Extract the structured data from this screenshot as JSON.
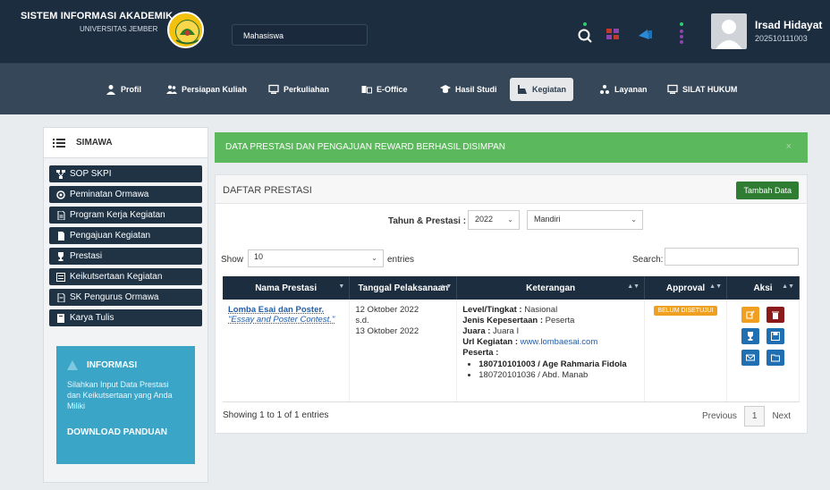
{
  "header": {
    "title": "SISTEM INFORMASI AKADEMIK",
    "subtitle": "UNIVERSITAS JEMBER",
    "role": "Mahasiswa",
    "user_name": "Irsad Hidayat",
    "user_nim": "202510111003"
  },
  "nav": {
    "items": [
      {
        "label": "Profil",
        "icon": "person-icon"
      },
      {
        "label": "Persiapan Kuliah",
        "icon": "users-icon"
      },
      {
        "label": "Perkuliahan",
        "icon": "screen-icon"
      },
      {
        "label": "E-Office",
        "icon": "office-icon"
      },
      {
        "label": "Hasil Studi",
        "icon": "graduation-icon"
      },
      {
        "label": "Kegiatan",
        "icon": "activity-icon"
      },
      {
        "label": "Layanan",
        "icon": "service-icon"
      },
      {
        "label": "SILAT HUKUM",
        "icon": "screen-icon"
      }
    ]
  },
  "sidebar": {
    "title": "SIMAWA",
    "items": [
      {
        "label": "SOP SKPI",
        "icon": "sitemap-icon"
      },
      {
        "label": "Peminatan Ormawa",
        "icon": "circle-icon"
      },
      {
        "label": "Program Kerja Kegiatan",
        "icon": "file-icon"
      },
      {
        "label": "Pengajuan Kegiatan",
        "icon": "file-icon"
      },
      {
        "label": "Prestasi",
        "icon": "trophy-icon"
      },
      {
        "label": "Keikutsertaan Kegiatan",
        "icon": "list-icon"
      },
      {
        "label": "SK Pengurus Ormawa",
        "icon": "file-icon"
      },
      {
        "label": "Karya Tulis",
        "icon": "book-icon"
      }
    ],
    "info": {
      "title": "INFORMASI",
      "text": "Silahkan Input Data Prestasi dan Keikutsertaan yang Anda Miliki",
      "download": "DOWNLOAD PANDUAN"
    }
  },
  "alert": {
    "message": "DATA PRESTASI DAN PENGAJUAN REWARD BERHASIL DISIMPAN",
    "close": "×"
  },
  "panel": {
    "title": "DAFTAR PRESTASI",
    "add_button": "Tambah Data",
    "filter_label": "Tahun & Prestasi",
    "filter_sep": ":",
    "year": "2022",
    "category": "Mandiri",
    "show_label": "Show",
    "show_value": "10",
    "entries_label": "entries",
    "search_label": "Search:",
    "columns": [
      "Nama Prestasi",
      "Tanggal Pelaksanaan",
      "Keterangan",
      "Approval",
      "Aksi"
    ],
    "row": {
      "name": "Lomba Esai dan Poster.",
      "name_en": "\"Essay and Poster Contest.\"",
      "date_start": "12 Oktober 2022",
      "date_sep": "s.d.",
      "date_end": "13 Oktober 2022",
      "level_label": "Level/Tingkat :",
      "level": "Nasional",
      "jenis_label": "Jenis Kepesertaan :",
      "jenis": "Peserta",
      "juara_label": "Juara :",
      "juara": "Juara I",
      "url_label": "Url Kegiatan :",
      "url": "www.lombaesai.com",
      "peserta_label": "Peserta :",
      "peserta": [
        "180710101003 / Age Rahmaria Fidola",
        "180720101036 / Abd. Manab"
      ],
      "approval": "BELUM DISETUJUI"
    },
    "footer_info": "Showing 1 to 1 of 1 entries",
    "prev": "Previous",
    "page": "1",
    "next": "Next"
  },
  "colors": {
    "header_bg": "#1c2d40",
    "nav_bg": "#37475a",
    "alert_bg": "#5cb85c",
    "info_bg": "#3aa5c7",
    "add_btn": "#2e7d32",
    "edit_btn": "#f0a020",
    "delete_btn": "#8b1a1a",
    "action_blue": "#1f6fb2"
  }
}
